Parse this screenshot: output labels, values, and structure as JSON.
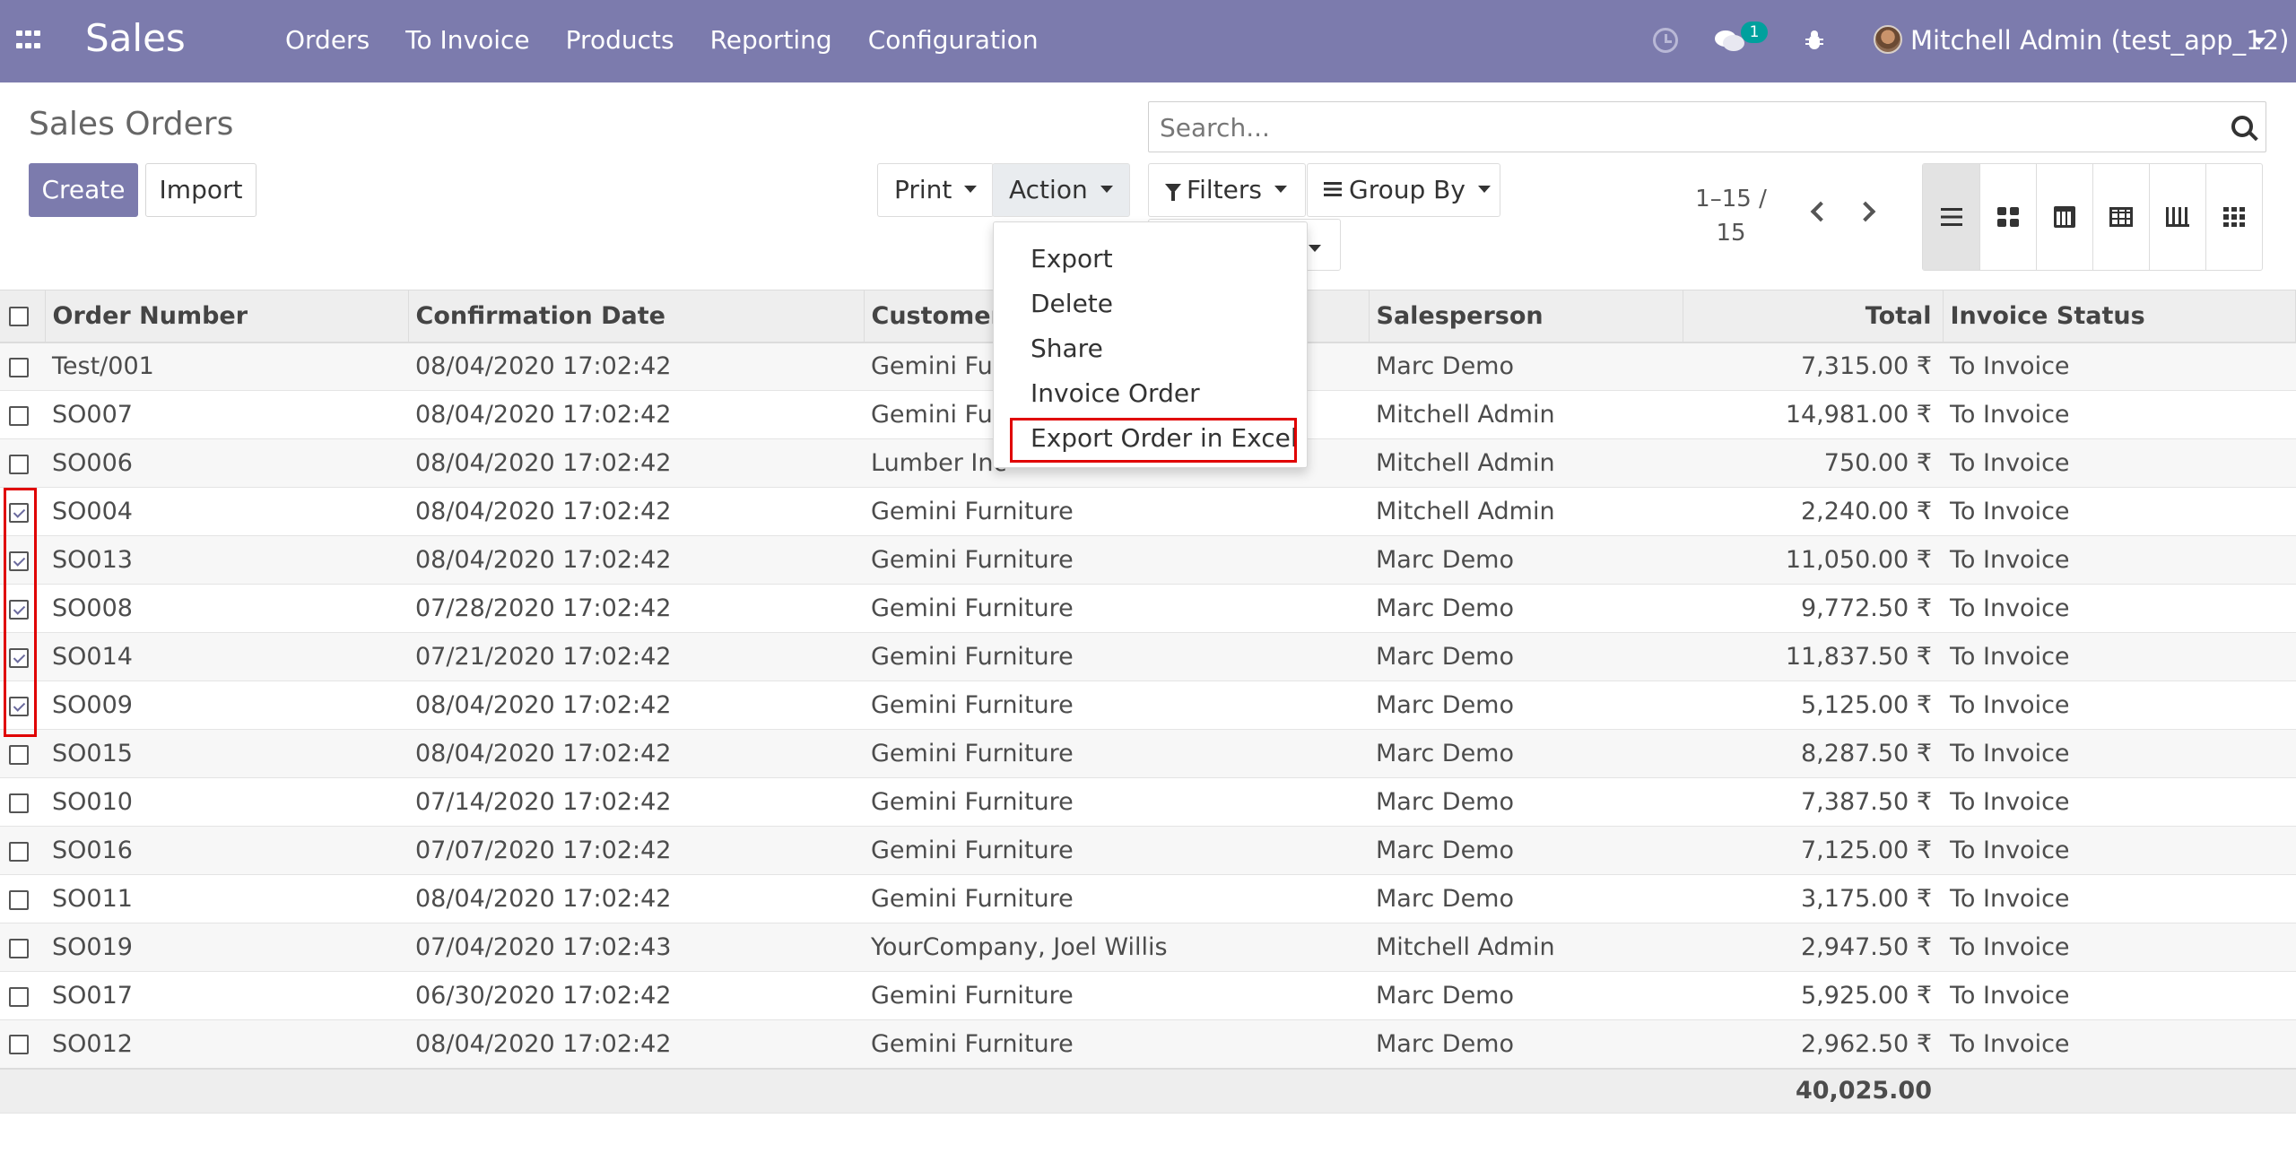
{
  "navbar": {
    "brand": "Sales",
    "menu": [
      "Orders",
      "To Invoice",
      "Products",
      "Reporting",
      "Configuration"
    ],
    "chat_badge": "1",
    "user_name": "Mitchell Admin (test_app_12)",
    "icons": [
      "apps-icon",
      "clock-icon",
      "chat-icon",
      "bug-icon",
      "avatar"
    ]
  },
  "control_panel": {
    "title": "Sales Orders",
    "create_label": "Create",
    "import_label": "Import",
    "print_label": "Print",
    "action_label": "Action",
    "filters_label": "Filters",
    "groupby_label": "Group By",
    "search_placeholder": "Search...",
    "pager": "1-15 / 15",
    "pager_line1": "1–15 /",
    "pager_line2": "15",
    "views": [
      "list",
      "kanban",
      "calendar",
      "pivot",
      "graph",
      "grid"
    ]
  },
  "action_menu": {
    "items": [
      "Export",
      "Delete",
      "Share",
      "Invoice Order",
      "Export Order in Excel"
    ],
    "highlighted": "Export Order in Excel"
  },
  "table": {
    "columns": [
      "Order Number",
      "Confirmation Date",
      "Customer",
      "Salesperson",
      "Total",
      "Invoice Status"
    ],
    "rows": [
      {
        "order": "Test/001",
        "date": "08/04/2020 17:02:42",
        "customer": "Gemini Fur",
        "salesperson": "Marc Demo",
        "total": "7,315.00 ₹",
        "status": "To Invoice",
        "checked": false
      },
      {
        "order": "SO007",
        "date": "08/04/2020 17:02:42",
        "customer": "Gemini Fur",
        "salesperson": "Mitchell Admin",
        "total": "14,981.00 ₹",
        "status": "To Invoice",
        "checked": false
      },
      {
        "order": "SO006",
        "date": "08/04/2020 17:02:42",
        "customer": "Lumber Inc",
        "salesperson": "Mitchell Admin",
        "total": "750.00 ₹",
        "status": "To Invoice",
        "checked": false
      },
      {
        "order": "SO004",
        "date": "08/04/2020 17:02:42",
        "customer": "Gemini Furniture",
        "salesperson": "Mitchell Admin",
        "total": "2,240.00 ₹",
        "status": "To Invoice",
        "checked": true
      },
      {
        "order": "SO013",
        "date": "08/04/2020 17:02:42",
        "customer": "Gemini Furniture",
        "salesperson": "Marc Demo",
        "total": "11,050.00 ₹",
        "status": "To Invoice",
        "checked": true
      },
      {
        "order": "SO008",
        "date": "07/28/2020 17:02:42",
        "customer": "Gemini Furniture",
        "salesperson": "Marc Demo",
        "total": "9,772.50 ₹",
        "status": "To Invoice",
        "checked": true
      },
      {
        "order": "SO014",
        "date": "07/21/2020 17:02:42",
        "customer": "Gemini Furniture",
        "salesperson": "Marc Demo",
        "total": "11,837.50 ₹",
        "status": "To Invoice",
        "checked": true
      },
      {
        "order": "SO009",
        "date": "08/04/2020 17:02:42",
        "customer": "Gemini Furniture",
        "salesperson": "Marc Demo",
        "total": "5,125.00 ₹",
        "status": "To Invoice",
        "checked": true
      },
      {
        "order": "SO015",
        "date": "08/04/2020 17:02:42",
        "customer": "Gemini Furniture",
        "salesperson": "Marc Demo",
        "total": "8,287.50 ₹",
        "status": "To Invoice",
        "checked": false
      },
      {
        "order": "SO010",
        "date": "07/14/2020 17:02:42",
        "customer": "Gemini Furniture",
        "salesperson": "Marc Demo",
        "total": "7,387.50 ₹",
        "status": "To Invoice",
        "checked": false
      },
      {
        "order": "SO016",
        "date": "07/07/2020 17:02:42",
        "customer": "Gemini Furniture",
        "salesperson": "Marc Demo",
        "total": "7,125.00 ₹",
        "status": "To Invoice",
        "checked": false
      },
      {
        "order": "SO011",
        "date": "08/04/2020 17:02:42",
        "customer": "Gemini Furniture",
        "salesperson": "Marc Demo",
        "total": "3,175.00 ₹",
        "status": "To Invoice",
        "checked": false
      },
      {
        "order": "SO019",
        "date": "07/04/2020 17:02:43",
        "customer": "YourCompany, Joel Willis",
        "salesperson": "Mitchell Admin",
        "total": "2,947.50 ₹",
        "status": "To Invoice",
        "checked": false
      },
      {
        "order": "SO017",
        "date": "06/30/2020 17:02:42",
        "customer": "Gemini Furniture",
        "salesperson": "Marc Demo",
        "total": "5,925.00 ₹",
        "status": "To Invoice",
        "checked": false
      },
      {
        "order": "SO012",
        "date": "08/04/2020 17:02:42",
        "customer": "Gemini Furniture",
        "salesperson": "Marc Demo",
        "total": "2,962.50 ₹",
        "status": "To Invoice",
        "checked": false
      }
    ],
    "footer_total": "40,025.00"
  },
  "colors": {
    "brand": "#7c7bad",
    "highlight": "#e00000",
    "badge": "#00a09d"
  }
}
